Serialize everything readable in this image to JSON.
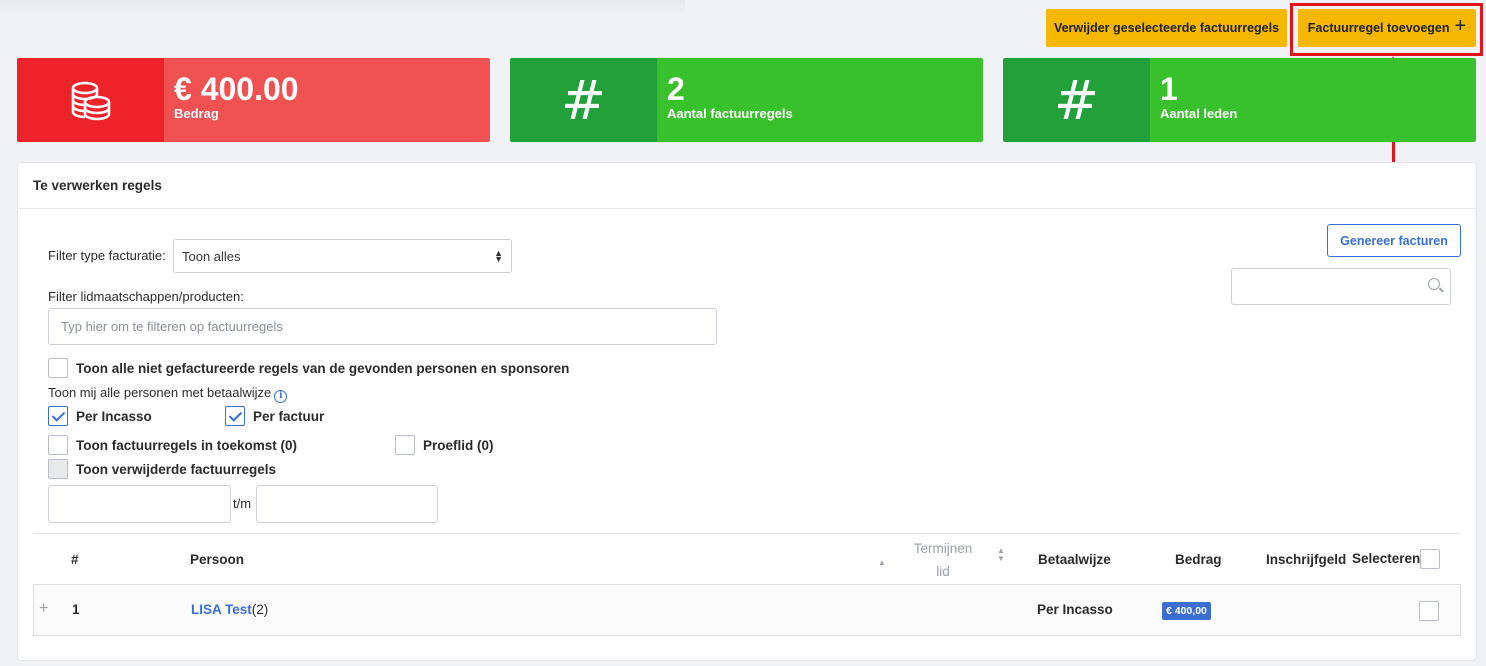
{
  "toolbar": {
    "delete_label": "Verwijder geselecteerde factuurregels",
    "add_label": "Factuurregel toevoegen",
    "add_icon": "+"
  },
  "stats": [
    {
      "value": "€ 400.00",
      "label": "Bedrag",
      "icon": "coins-icon",
      "icon_bg": "#ee2329",
      "bg": "#f05252"
    },
    {
      "value": "2",
      "label": "Aantal factuurregels",
      "icon": "hash-icon",
      "icon_glyph": "#",
      "icon_bg": "#22a03a",
      "bg": "#38c12c"
    },
    {
      "value": "1",
      "label": "Aantal leden",
      "icon": "hash-icon",
      "icon_glyph": "#",
      "icon_bg": "#22a03a",
      "bg": "#38c12c"
    }
  ],
  "panel": {
    "title": "Te verwerken regels",
    "filter_type_label": "Filter type facturatie:",
    "filter_type_value": "Toon alles",
    "filter_products_label": "Filter lidmaatschappen/producten:",
    "filter_products_placeholder": "Typ hier om te filteren op factuurregels",
    "show_all_label": "Toon alle niet gefactureerde regels van de gevonden personen en sponsoren",
    "payment_method_label": "Toon mij alle personen met betaalwijze",
    "per_incasso_label": "Per Incasso",
    "per_factuur_label": "Per factuur",
    "future_label": "Toon factuurregels in toekomst (0)",
    "trial_label": "Proeflid (0)",
    "deleted_label": "Toon verwijderde factuurregels",
    "range_sep": "t/m",
    "generate_label": "Genereer facturen",
    "search_value": ""
  },
  "table": {
    "headers": {
      "num": "#",
      "person": "Persoon",
      "terms_line1": "Termijnen",
      "terms_line2": "lid",
      "payment": "Betaalwijze",
      "amount": "Bedrag",
      "fee": "Inschrijfgeld",
      "select": "Selecteren"
    },
    "rows": [
      {
        "expand": "+",
        "num": "1",
        "person": "LISA Test",
        "count": "(2)",
        "terms": "",
        "payment": "Per Incasso",
        "amount": "€ 400,00",
        "fee": ""
      }
    ]
  },
  "colors": {
    "accent_yellow": "#f5b700",
    "link_blue": "#3a6fd1",
    "highlight_red": "#e4121a"
  }
}
